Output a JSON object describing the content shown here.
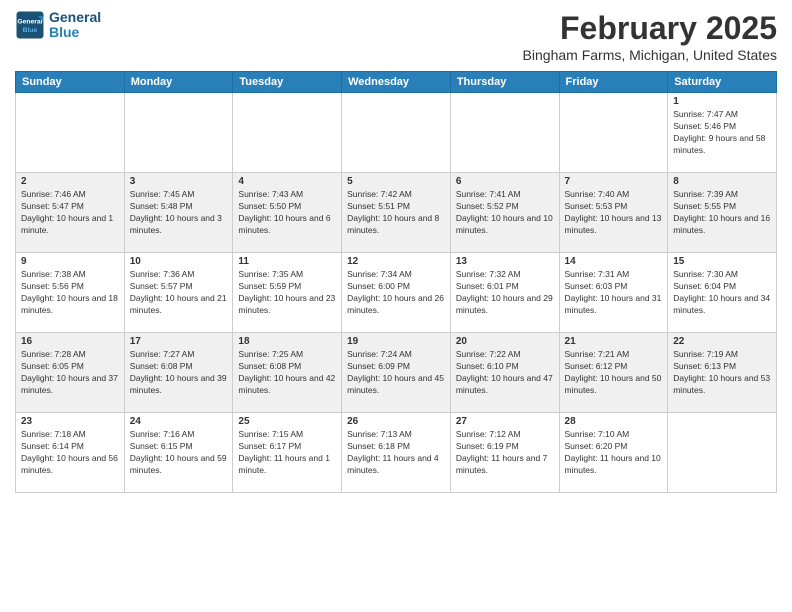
{
  "header": {
    "logo_line1": "General",
    "logo_line2": "Blue",
    "month_year": "February 2025",
    "location": "Bingham Farms, Michigan, United States"
  },
  "days_of_week": [
    "Sunday",
    "Monday",
    "Tuesday",
    "Wednesday",
    "Thursday",
    "Friday",
    "Saturday"
  ],
  "weeks": [
    [
      {
        "day": "",
        "info": ""
      },
      {
        "day": "",
        "info": ""
      },
      {
        "day": "",
        "info": ""
      },
      {
        "day": "",
        "info": ""
      },
      {
        "day": "",
        "info": ""
      },
      {
        "day": "",
        "info": ""
      },
      {
        "day": "1",
        "info": "Sunrise: 7:47 AM\nSunset: 5:46 PM\nDaylight: 9 hours and 58 minutes."
      }
    ],
    [
      {
        "day": "2",
        "info": "Sunrise: 7:46 AM\nSunset: 5:47 PM\nDaylight: 10 hours and 1 minute."
      },
      {
        "day": "3",
        "info": "Sunrise: 7:45 AM\nSunset: 5:48 PM\nDaylight: 10 hours and 3 minutes."
      },
      {
        "day": "4",
        "info": "Sunrise: 7:43 AM\nSunset: 5:50 PM\nDaylight: 10 hours and 6 minutes."
      },
      {
        "day": "5",
        "info": "Sunrise: 7:42 AM\nSunset: 5:51 PM\nDaylight: 10 hours and 8 minutes."
      },
      {
        "day": "6",
        "info": "Sunrise: 7:41 AM\nSunset: 5:52 PM\nDaylight: 10 hours and 10 minutes."
      },
      {
        "day": "7",
        "info": "Sunrise: 7:40 AM\nSunset: 5:53 PM\nDaylight: 10 hours and 13 minutes."
      },
      {
        "day": "8",
        "info": "Sunrise: 7:39 AM\nSunset: 5:55 PM\nDaylight: 10 hours and 16 minutes."
      }
    ],
    [
      {
        "day": "9",
        "info": "Sunrise: 7:38 AM\nSunset: 5:56 PM\nDaylight: 10 hours and 18 minutes."
      },
      {
        "day": "10",
        "info": "Sunrise: 7:36 AM\nSunset: 5:57 PM\nDaylight: 10 hours and 21 minutes."
      },
      {
        "day": "11",
        "info": "Sunrise: 7:35 AM\nSunset: 5:59 PM\nDaylight: 10 hours and 23 minutes."
      },
      {
        "day": "12",
        "info": "Sunrise: 7:34 AM\nSunset: 6:00 PM\nDaylight: 10 hours and 26 minutes."
      },
      {
        "day": "13",
        "info": "Sunrise: 7:32 AM\nSunset: 6:01 PM\nDaylight: 10 hours and 29 minutes."
      },
      {
        "day": "14",
        "info": "Sunrise: 7:31 AM\nSunset: 6:03 PM\nDaylight: 10 hours and 31 minutes."
      },
      {
        "day": "15",
        "info": "Sunrise: 7:30 AM\nSunset: 6:04 PM\nDaylight: 10 hours and 34 minutes."
      }
    ],
    [
      {
        "day": "16",
        "info": "Sunrise: 7:28 AM\nSunset: 6:05 PM\nDaylight: 10 hours and 37 minutes."
      },
      {
        "day": "17",
        "info": "Sunrise: 7:27 AM\nSunset: 6:08 PM\nDaylight: 10 hours and 39 minutes."
      },
      {
        "day": "18",
        "info": "Sunrise: 7:25 AM\nSunset: 6:08 PM\nDaylight: 10 hours and 42 minutes."
      },
      {
        "day": "19",
        "info": "Sunrise: 7:24 AM\nSunset: 6:09 PM\nDaylight: 10 hours and 45 minutes."
      },
      {
        "day": "20",
        "info": "Sunrise: 7:22 AM\nSunset: 6:10 PM\nDaylight: 10 hours and 47 minutes."
      },
      {
        "day": "21",
        "info": "Sunrise: 7:21 AM\nSunset: 6:12 PM\nDaylight: 10 hours and 50 minutes."
      },
      {
        "day": "22",
        "info": "Sunrise: 7:19 AM\nSunset: 6:13 PM\nDaylight: 10 hours and 53 minutes."
      }
    ],
    [
      {
        "day": "23",
        "info": "Sunrise: 7:18 AM\nSunset: 6:14 PM\nDaylight: 10 hours and 56 minutes."
      },
      {
        "day": "24",
        "info": "Sunrise: 7:16 AM\nSunset: 6:15 PM\nDaylight: 10 hours and 59 minutes."
      },
      {
        "day": "25",
        "info": "Sunrise: 7:15 AM\nSunset: 6:17 PM\nDaylight: 11 hours and 1 minute."
      },
      {
        "day": "26",
        "info": "Sunrise: 7:13 AM\nSunset: 6:18 PM\nDaylight: 11 hours and 4 minutes."
      },
      {
        "day": "27",
        "info": "Sunrise: 7:12 AM\nSunset: 6:19 PM\nDaylight: 11 hours and 7 minutes."
      },
      {
        "day": "28",
        "info": "Sunrise: 7:10 AM\nSunset: 6:20 PM\nDaylight: 11 hours and 10 minutes."
      },
      {
        "day": "",
        "info": ""
      }
    ]
  ]
}
